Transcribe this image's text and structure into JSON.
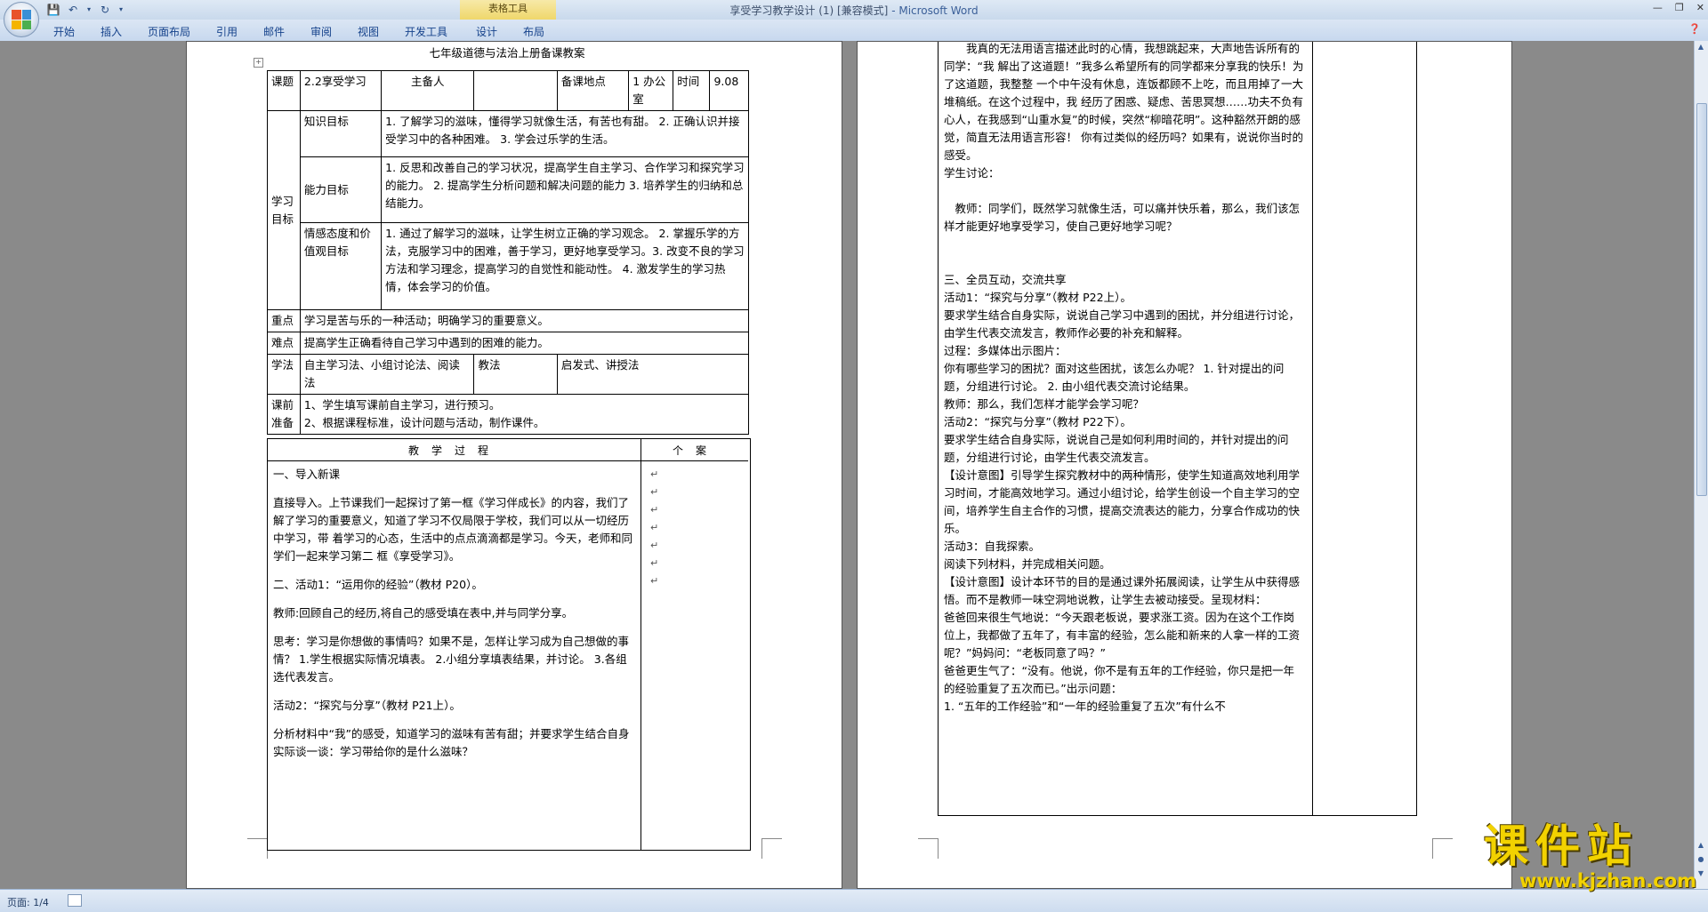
{
  "window": {
    "title": "享受学习教学设计 (1) [兼容模式]",
    "app": " - Microsoft Word",
    "context_tab_group": "表格工具"
  },
  "ribbon": {
    "tabs": [
      "开始",
      "插入",
      "页面布局",
      "引用",
      "邮件",
      "审阅",
      "视图",
      "开发工具",
      "设计",
      "布局"
    ]
  },
  "page1": {
    "title": "七年级道德与法治上册备课教案",
    "table": {
      "course_label": "课题",
      "course_value": "2.2享受学习",
      "preparer_label": "主备人",
      "location_label": "备课地点",
      "location_value": "1 办公室",
      "time_label": "时间",
      "time_value": "9.08",
      "goals_label": "学习目标",
      "knowledge_label": "知识目标",
      "knowledge_text": "1. 了解学习的滋味，懂得学习就像生活，有苦也有甜。 2. 正确认识并接受学习中的各种困难。 3. 学会过乐学的生活。",
      "ability_label": "能力目标",
      "ability_text": "1. 反思和改善自己的学习状况，提高学生自主学习、合作学习和探究学习的能力。 2. 提高学生分析问题和解决问题的能力 3. 培养学生的归纳和总结能力。",
      "emotion_label": "情感态度和价值观目标",
      "emotion_text": "1. 通过了解学习的滋味，让学生树立正确的学习观念。 2. 掌握乐学的方法，克服学习中的困难，善于学习，更好地享受学习。3. 改变不良的学习方法和学习理念，提高学习的自觉性和能动性。 4. 激发学生的学习热情，体会学习的价值。",
      "key_label": "重点",
      "key_text": "学习是苦与乐的一种活动；明确学习的重要意义。",
      "diff_label": "难点",
      "diff_text": "提高学生正确看待自己学习中遇到的困难的能力。",
      "study_method_label": "学法",
      "study_method_text": "自主学习法、小组讨论法、阅读法",
      "teach_method_label": "教法",
      "teach_method_text": "启发式、讲授法",
      "prep_label": "课前准备",
      "prep_text_1": "1、学生填写课前自主学习，进行预习。",
      "prep_text_2": "2、根据课程标准，设计问题与活动，制作课件。"
    },
    "process_header": "教学过程",
    "case_header": "个案",
    "process_paragraphs": [
      "一、导入新课",
      "直接导入。上节课我们一起探讨了第一框《学习伴成长》的内容，我们了解了学习的重要意义，知道了学习不仅局限于学校，我们可以从一切经历中学习，带 着学习的心态，生活中的点点滴滴都是学习。今天，老师和同学们一起来学习第二 框《享受学习》。",
      "二、活动1：“运用你的经验”（教材 P20）。",
      "教师:回顾自己的经历,将自己的感受填在表中,并与同学分享。",
      "思考：学习是你想做的事情吗？如果不是，怎样让学习成为自己想做的事情？ 1.学生根据实际情况填表。 2.小组分享填表结果，并讨论。 3.各组选代表发言。",
      "活动2：“探究与分享”（教材 P21上）。",
      "分析材料中“我”的感受，知道学习的滋味有苦有甜；并要求学生结合自身实际谈一谈：学习带给你的是什么滋味？"
    ]
  },
  "page2": {
    "lines": [
      "我真的无法用语言描述此时的心情，我想跳起来，大声地告诉所有的同学：“我 解出了这道题！”我多么希望所有的同学都来分享我的快乐！为了这道题，我整整 一个中午没有休息，连饭都顾不上吃，而且用掉了一大堆稿纸。在这个过程中，我 经历了困惑、疑虑、苦思冥想……功夫不负有心人，在我感到“山重水复”的时候，突然“柳暗花明”。这种豁然开朗的感觉，简直无法用语言形容！ 你有过类似的经历吗？如果有，说说你当时的感受。",
      "学生讨论：",
      "",
      "教师：同学们，既然学习就像生活，可以痛并快乐着，那么，我们该怎样才能更好地享受学习，使自己更好地学习呢？",
      "",
      "三、全员互动，交流共享",
      "活动1：“探究与分享”（教材 P22上）。",
      "要求学生结合自身实际，说说自己学习中遇到的困扰，并分组进行讨论，由学生代表交流发言，教师作必要的补充和解释。",
      "过程：多媒体出示图片：",
      "你有哪些学习的困扰？面对这些困扰，该怎么办呢？ 1. 针对提出的问题，分组进行讨论。 2. 由小组代表交流讨论结果。",
      "教师：那么，我们怎样才能学会学习呢？",
      "活动2：“探究与分享”（教材 P22下）。",
      "要求学生结合自身实际，说说自己是如何利用时间的，并针对提出的问题，分组进行讨论，由学生代表交流发言。",
      "【设计意图】引导学生探究教材中的两种情形，使学生知道高效地利用学习时间，才能高效地学习。通过小组讨论，给学生创设一个自主学习的空间，培养学生自主合作的习惯，提高交流表达的能力，分享合作成功的快乐。",
      "活动3：自我探索。",
      "阅读下列材料，并完成相关问题。",
      "【设计意图】设计本环节的目的是通过课外拓展阅读，让学生从中获得感悟。而不是教师一味空洞地说教，让学生去被动接受。呈现材料：",
      "爸爸回来很生气地说：“今天跟老板说，要求涨工资。因为在这个工作岗位上，我都做了五年了，有丰富的经验，怎么能和新来的人拿一样的工资呢？”妈妈问：“老板同意了吗？”",
      "爸爸更生气了：“没有。他说，你不是有五年的工作经验，你只是把一年的经验重复了五次而已。”出示问题：",
      "1. “五年的工作经验”和“一年的经验重复了五次”有什么不"
    ]
  },
  "statusbar": {
    "pages": "页面: 1/4"
  },
  "watermark": {
    "main": "课件站",
    "url": "www.kjzhan.com"
  },
  "colors": {
    "title_app": "#3a5f98",
    "tab_text": "#15428b",
    "context_tab": "#efd76b",
    "watermark": "#f2d200"
  }
}
